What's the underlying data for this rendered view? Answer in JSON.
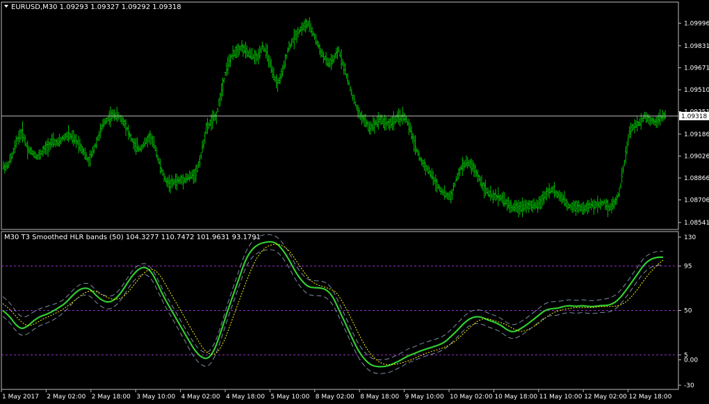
{
  "header": {
    "main_title": "EURUSD,M30  1.09293 1.09327 1.09292 1.09318",
    "indicator_title": "M30  T3 Smoothed HLR bands (50) 104.3277 110.7472 101.9631 93.1791"
  },
  "colors": {
    "background": "#000000",
    "frame": "#c0c0c0",
    "price_bars": "#00c000",
    "hlr_line": "#32cd32",
    "signal_line": "#ffff00",
    "bands": "#7f8fa6",
    "levels": "#9933cc",
    "price_line": "#c0c0c0"
  },
  "chart_data": [
    {
      "type": "ohlc",
      "title": "EURUSD,M30  1.09293 1.09327 1.09292 1.09318",
      "ylim": [
        1.0849,
        1.1015
      ],
      "y_ticks": [
        "1.09996",
        "1.09831",
        "1.09671",
        "1.09510",
        "1.09351",
        "1.09186",
        "1.09026",
        "1.08866",
        "1.08706",
        "1.08541"
      ],
      "current_price": "1.09318",
      "series": [
        {
          "name": "EURUSD",
          "close": [
            1.0895,
            1.0903,
            1.0915,
            1.092,
            1.0908,
            1.0905,
            1.0902,
            1.0906,
            1.091,
            1.0913,
            1.0912,
            1.0916,
            1.0918,
            1.0915,
            1.0912,
            1.0906,
            1.0898,
            1.0908,
            1.0918,
            1.0927,
            1.0931,
            1.0933,
            1.0931,
            1.0927,
            1.0918,
            1.091,
            1.0908,
            1.0912,
            1.0917,
            1.0909,
            1.0895,
            1.0885,
            1.0882,
            1.0884,
            1.0885,
            1.0886,
            1.0888,
            1.089,
            1.0903,
            1.0922,
            1.0928,
            1.0932,
            1.095,
            1.0967,
            1.0975,
            1.098,
            1.0982,
            1.0978,
            1.0976,
            1.0974,
            1.0983,
            1.0977,
            1.0963,
            1.0955,
            1.0964,
            1.098,
            1.0987,
            1.0993,
            1.0997,
            1.0999,
            1.0992,
            1.0983,
            1.0975,
            1.097,
            1.0973,
            1.098,
            1.0968,
            1.0955,
            1.0943,
            1.0933,
            1.0929,
            1.0923,
            1.0926,
            1.093,
            1.0927,
            1.0926,
            1.0929,
            1.0931,
            1.0931,
            1.0922,
            1.091,
            1.09,
            1.0895,
            1.089,
            1.0883,
            1.0878,
            1.0874,
            1.0873,
            1.0885,
            1.0894,
            1.0898,
            1.0896,
            1.089,
            1.0883,
            1.0877,
            1.0873,
            1.0873,
            1.0872,
            1.0868,
            1.0865,
            1.0865,
            1.0866,
            1.0867,
            1.0866,
            1.0867,
            1.0871,
            1.0877,
            1.0878,
            1.0874,
            1.0871,
            1.0866,
            1.0866,
            1.0866,
            1.0864,
            1.0866,
            1.0867,
            1.0867,
            1.0869,
            1.0865,
            1.0868,
            1.0876,
            1.0898,
            1.092,
            1.0925,
            1.0927,
            1.0932,
            1.0929,
            1.0928,
            1.093,
            1.0932
          ]
        }
      ]
    },
    {
      "type": "line",
      "title": "M30  T3 Smoothed HLR bands (50) 104.3277 110.7472 101.9631 93.1791",
      "ylim": [
        -30,
        130
      ],
      "y_ticks": [
        "130",
        "95",
        "50",
        "5",
        "0.00",
        "-30"
      ],
      "levels": [
        95,
        50,
        5
      ],
      "x_ticks": [
        "1 May 2017",
        "2 May 02:00",
        "2 May 18:00",
        "3 May 10:00",
        "4 May 02:00",
        "4 May 18:00",
        "5 May 10:00",
        "8 May 02:00",
        "8 May 18:00",
        "9 May 10:00",
        "10 May 02:00",
        "10 May 18:00",
        "11 May 10:00",
        "12 May 02:00",
        "12 May 18:00"
      ],
      "series": [
        {
          "role": "hlr",
          "values": [
            50,
            45,
            36,
            31,
            34,
            40,
            44,
            46,
            49,
            53,
            57,
            64,
            70,
            73,
            72,
            65,
            60,
            58,
            61,
            68,
            78,
            87,
            93,
            94,
            88,
            75,
            62,
            51,
            40,
            29,
            18,
            8,
            2,
            1,
            10,
            28,
            48,
            66,
            84,
            102,
            112,
            117,
            119,
            120,
            118,
            111,
            101,
            89,
            80,
            74,
            73,
            73,
            71,
            64,
            50,
            37,
            23,
            10,
            1,
            -5,
            -7,
            -7,
            -6,
            -3,
            0,
            4,
            6,
            9,
            11,
            13,
            15,
            18,
            24,
            30,
            37,
            42,
            44,
            43,
            40,
            38,
            35,
            30,
            28,
            31,
            35,
            40,
            45,
            50,
            52,
            52,
            54,
            55,
            54,
            55,
            54,
            54,
            55,
            55,
            57,
            62,
            70,
            79,
            88,
            97,
            102,
            104,
            104
          ]
        },
        {
          "role": "signal",
          "values": [
            57,
            52,
            45,
            38,
            34,
            36,
            40,
            43,
            46,
            49,
            53,
            58,
            63,
            68,
            70,
            69,
            65,
            62,
            61,
            63,
            69,
            77,
            85,
            91,
            92,
            86,
            75,
            64,
            53,
            42,
            31,
            20,
            10,
            5,
            6,
            16,
            32,
            50,
            67,
            84,
            99,
            109,
            115,
            117,
            117,
            114,
            107,
            97,
            88,
            80,
            76,
            74,
            72,
            69,
            59,
            47,
            34,
            21,
            10,
            2,
            -3,
            -5,
            -5,
            -4,
            -2,
            0,
            3,
            6,
            8,
            10,
            12,
            15,
            19,
            25,
            31,
            37,
            41,
            42,
            40,
            38,
            36,
            32,
            29,
            29,
            32,
            36,
            41,
            46,
            49,
            51,
            52,
            53,
            53,
            53,
            53,
            54,
            54,
            54,
            55,
            58,
            64,
            72,
            81,
            89,
            96,
            101
          ]
        },
        {
          "role": "band",
          "values": [
            64,
            59,
            50,
            43,
            44,
            49,
            52,
            54,
            56,
            58,
            62,
            69,
            75,
            78,
            77,
            70,
            66,
            64,
            66,
            73,
            83,
            92,
            97,
            98,
            92,
            80,
            67,
            57,
            46,
            35,
            24,
            14,
            8,
            7,
            16,
            34,
            55,
            74,
            92,
            110,
            120,
            125,
            127,
            127,
            125,
            118,
            108,
            96,
            87,
            81,
            80,
            80,
            78,
            71,
            57,
            44,
            30,
            17,
            8,
            2,
            0,
            0,
            1,
            4,
            7,
            11,
            13,
            16,
            18,
            20,
            22,
            25,
            31,
            37,
            44,
            49,
            51,
            50,
            47,
            45,
            42,
            37,
            35,
            38,
            42,
            47,
            52,
            57,
            59,
            59,
            60,
            61,
            60,
            61,
            60,
            60,
            61,
            62,
            64,
            69,
            77,
            86,
            95,
            104,
            108,
            110,
            110
          ]
        },
        {
          "role": "band",
          "values": [
            44,
            39,
            30,
            24,
            26,
            31,
            35,
            37,
            40,
            44,
            49,
            56,
            63,
            66,
            65,
            58,
            53,
            51,
            54,
            61,
            71,
            80,
            86,
            87,
            81,
            68,
            55,
            44,
            33,
            22,
            10,
            0,
            -6,
            -7,
            2,
            20,
            40,
            58,
            76,
            94,
            104,
            109,
            111,
            112,
            110,
            103,
            93,
            81,
            72,
            66,
            65,
            65,
            63,
            56,
            43,
            30,
            16,
            3,
            -6,
            -12,
            -14,
            -14,
            -13,
            -10,
            -7,
            -3,
            -1,
            2,
            4,
            6,
            8,
            11,
            17,
            23,
            30,
            35,
            37,
            36,
            33,
            31,
            28,
            23,
            21,
            24,
            28,
            33,
            38,
            43,
            45,
            45,
            47,
            48,
            47,
            48,
            47,
            47,
            48,
            48,
            50,
            55,
            63,
            72,
            81,
            89,
            94,
            96,
            96
          ]
        }
      ]
    }
  ]
}
